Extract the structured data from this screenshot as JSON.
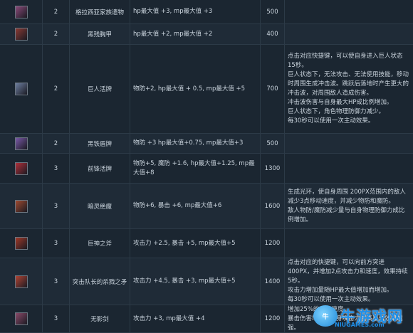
{
  "rows": [
    {
      "icon": "relic-scroll-icon",
      "icon_color": "#8a4a7a",
      "level": "2",
      "name": "格拉西亚家族遗物",
      "attr": "hp最大值 +3, mp最大值 +3",
      "price": "500",
      "desc": ""
    },
    {
      "icon": "armor-icon",
      "icon_color": "#8a3a34",
      "level": "2",
      "name": "黑残胸甲",
      "attr": "hp最大值 +2, mp最大值 +2",
      "price": "400",
      "desc": ""
    },
    {
      "icon": "giant-gauntlet-icon",
      "icon_color": "#6d7ea0",
      "level": "2",
      "name": "巨人活牌",
      "attr": "物防+2, hp最大值 + 0.5, mp最大值 +5",
      "price": "700",
      "desc": "点击对应快捷键，可以使自身进入巨人状态15秒。\n巨人状态下，无法攻击、无法使用技能，移动时周围生成冲击波。跳跃后落地时产生更大的冲击波，对周围敌人造成伤害。\n冲击波伤害与自身最大HP成比例增加。\n巨人状态下，角色物理防御力减少。\n每30秒可以使用一次主动效果。"
    },
    {
      "icon": "crystal-icon",
      "icon_color": "#7a5aa8",
      "level": "2",
      "name": "黑铁盾牌",
      "attr": "物防 +3 hp最大值+0.75, mp最大值+3",
      "price": "500",
      "desc": ""
    },
    {
      "icon": "shield-icon",
      "icon_color": "#b0303a",
      "level": "3",
      "name": "前锋活牌",
      "attr": "物防+5, 魔防 +1.6, hp最大值+1.25, mp最大值+8",
      "price": "1300",
      "desc": ""
    },
    {
      "icon": "helmet-icon",
      "icon_color": "#a04a30",
      "level": "3",
      "name": "暗灵绝魔",
      "attr": "物防+6, 暴击 +6, mp最大值+6",
      "price": "1600",
      "desc": "生成光环，使自身周围 200PX范围内的敌人减少3点移动速度，并减少物防和魔防。\n敌人物防/魔防减少量与自身物理防御力成比例增加。"
    },
    {
      "icon": "axe-icon",
      "icon_color": "#a03828",
      "level": "3",
      "name": "巨神之斧",
      "attr": "攻击力 +2.5, 暴击 +5, mp最大值+5",
      "price": "1200",
      "desc": ""
    },
    {
      "icon": "spear-icon",
      "icon_color": "#b04434",
      "level": "3",
      "name": "突击队长的杀戮之矛",
      "attr": "攻击力 +4.5, 暴击 +3, mp最大值+5",
      "price": "1400",
      "desc": "点击对应的快捷键，可以向前方突进400PX，并增加2点攻击力和速度，效果持续5秒。\n攻击力增加量随HP最大值增加而增加。\n每30秒可以使用一次主动效果。"
    },
    {
      "icon": "sword-icon",
      "icon_color": "#8a4a6a",
      "level": "3",
      "name": "无影剑",
      "attr": "攻击力 +3, mp最大值 +4",
      "price": "1200",
      "desc": "增加25%的攻击速度。\n暴击伤害增加，自身攻击力越高暴击效果越强。"
    }
  ],
  "watermark": {
    "text": "牛游戏网",
    "url": "NIUGAMES.com",
    "badge": "牛"
  }
}
